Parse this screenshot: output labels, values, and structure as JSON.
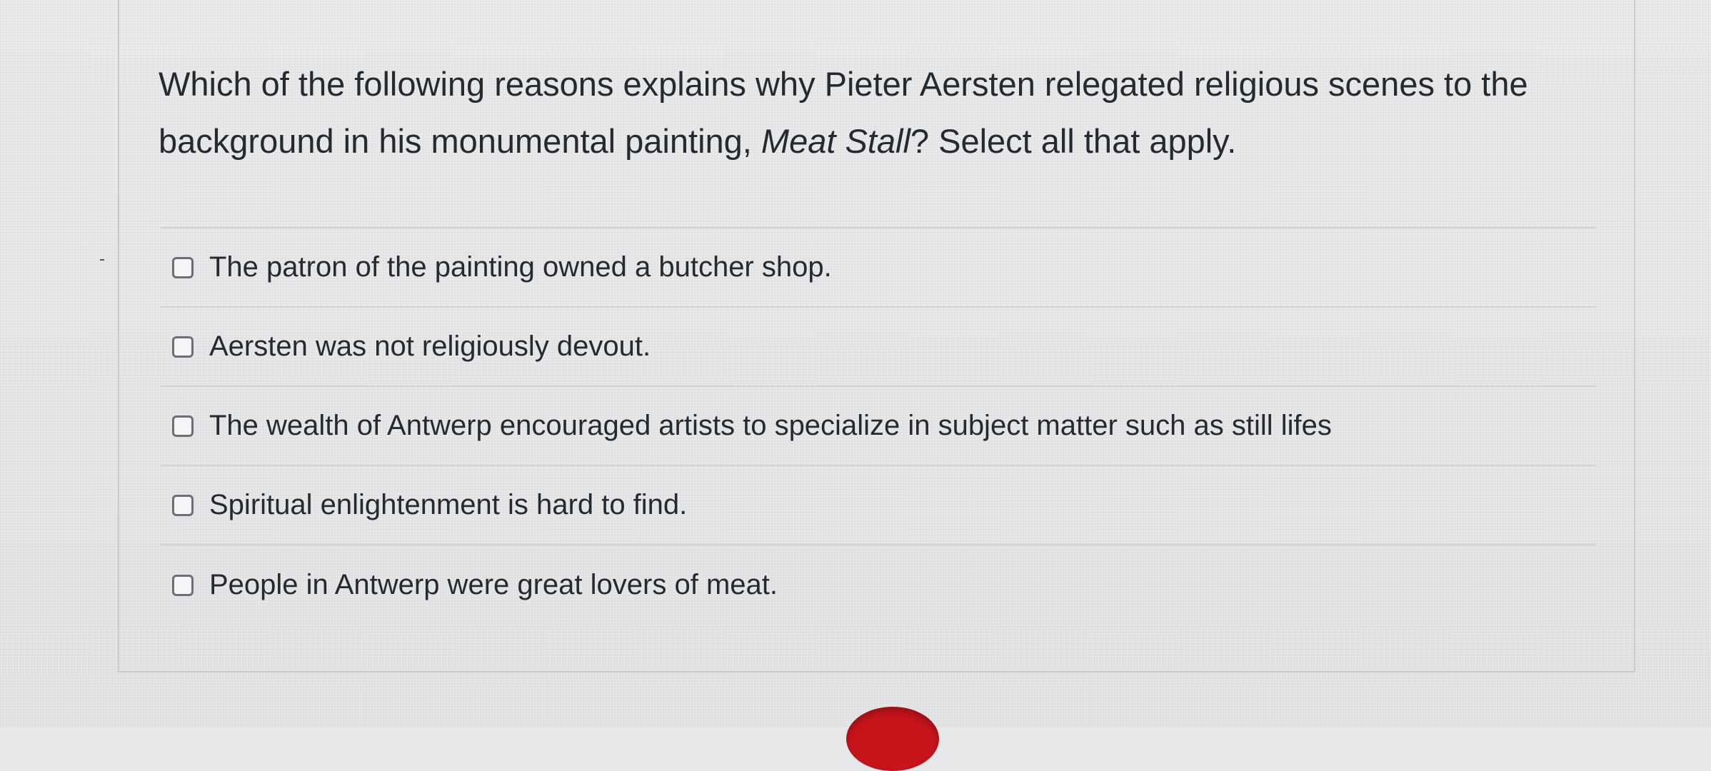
{
  "question": {
    "text_before": "Which of the following reasons explains why Pieter Aersten relegated religious scenes to the background in his monumental painting, ",
    "title_italic": "Meat Stall",
    "text_after": "? Select all that apply."
  },
  "answers": [
    {
      "label": "The patron of the painting owned a butcher shop.",
      "checked": false
    },
    {
      "label": "Aersten was not religiously devout.",
      "checked": false
    },
    {
      "label": "The wealth of Antwerp encouraged artists to specialize in subject matter such as still lifes",
      "checked": false
    },
    {
      "label": "Spiritual enlightenment is hard to find.",
      "checked": false
    },
    {
      "label": "People in Antwerp were great lovers of meat.",
      "checked": false
    }
  ],
  "colors": {
    "text": "#262a2e",
    "border": "#d0d2d4",
    "checkbox_border": "#6c7075",
    "red_button": "#c8141b"
  }
}
